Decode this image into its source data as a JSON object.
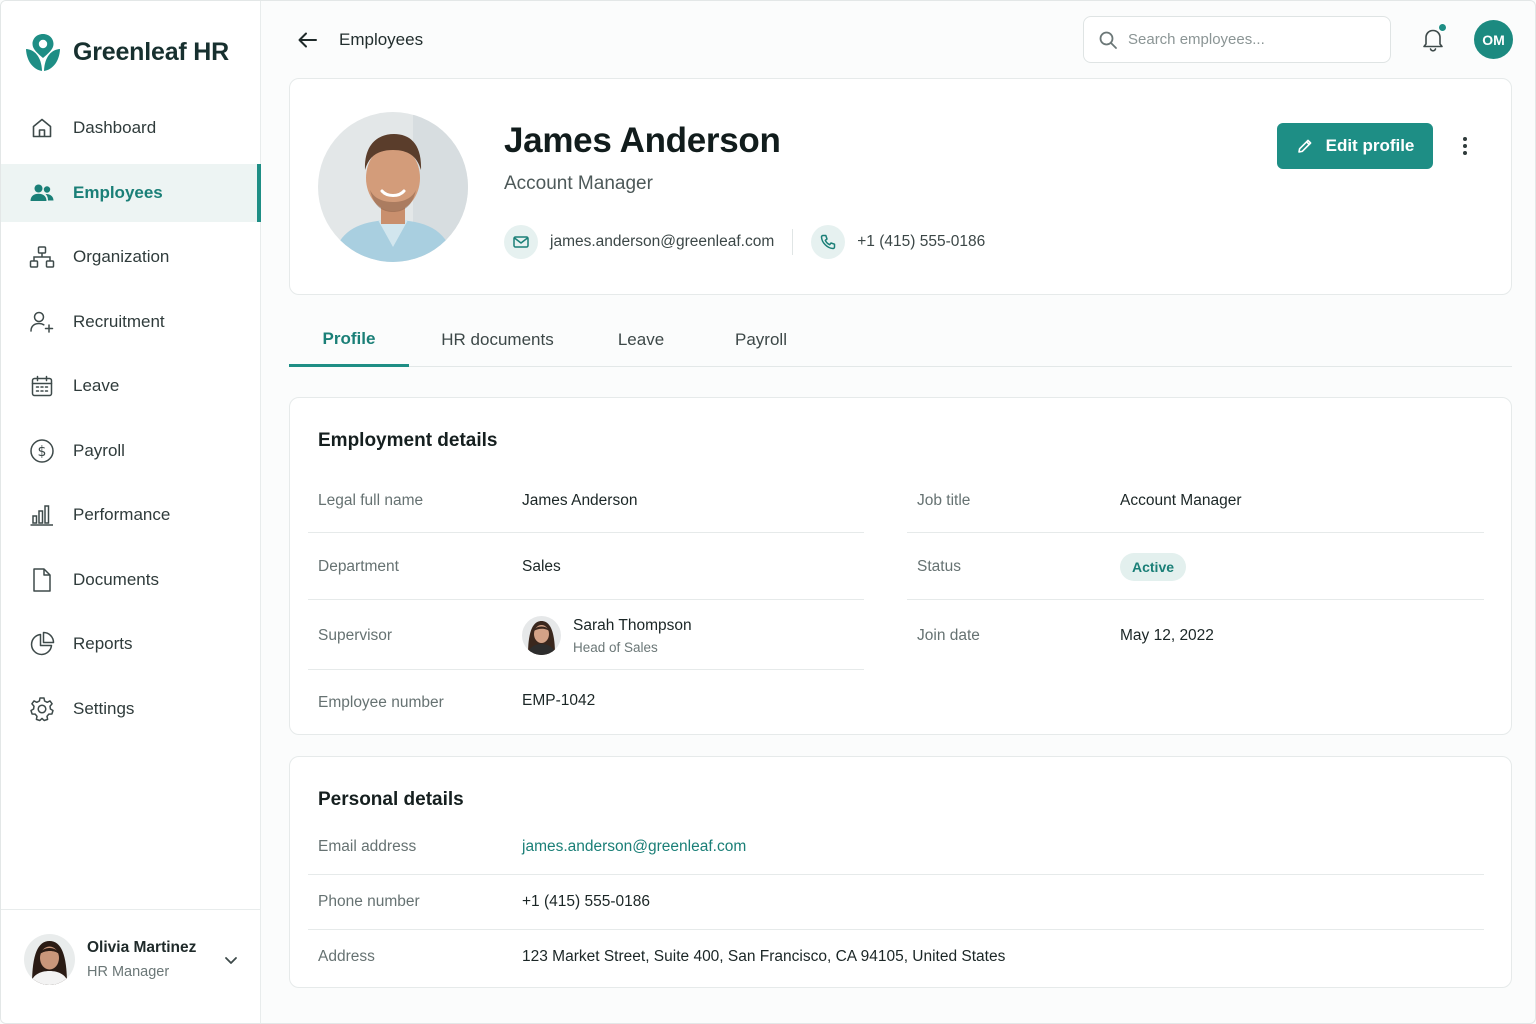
{
  "brand": {
    "name": "Greenleaf HR",
    "accent": "#1e8e85"
  },
  "sidebar": {
    "items": [
      {
        "label": "Dashboard",
        "icon": "home-icon"
      },
      {
        "label": "Employees",
        "icon": "users-icon",
        "active": true
      },
      {
        "label": "Organization",
        "icon": "org-chart-icon"
      },
      {
        "label": "Recruitment",
        "icon": "user-add-icon"
      },
      {
        "label": "Leave",
        "icon": "calendar-icon"
      },
      {
        "label": "Payroll",
        "icon": "dollar-icon"
      },
      {
        "label": "Performance",
        "icon": "bar-chart-icon"
      },
      {
        "label": "Documents",
        "icon": "document-icon"
      },
      {
        "label": "Reports",
        "icon": "pie-chart-icon"
      },
      {
        "label": "Settings",
        "icon": "gear-icon"
      }
    ],
    "user": {
      "name": "Olivia Martinez",
      "role": "HR Manager"
    }
  },
  "topbar": {
    "breadcrumb": "Employees",
    "search_placeholder": "Search employees...",
    "avatar_initials": "OM"
  },
  "profile": {
    "name": "James Anderson",
    "title": "Account Manager",
    "email": "james.anderson@greenleaf.com",
    "phone": "+1 (415) 555-0186",
    "edit_label": "Edit profile"
  },
  "tabs": [
    "Profile",
    "HR documents",
    "Leave",
    "Payroll"
  ],
  "employment": {
    "title": "Employment details",
    "legal_name_label": "Legal full name",
    "legal_name": "James Anderson",
    "job_title_label": "Job title",
    "job_title": "Account Manager",
    "department_label": "Department",
    "department": "Sales",
    "status_label": "Status",
    "status": "Active",
    "supervisor_label": "Supervisor",
    "supervisor_name": "Sarah Thompson",
    "supervisor_role": "Head of Sales",
    "join_date_label": "Join date",
    "join_date": "May 12, 2022",
    "employee_number_label": "Employee number",
    "employee_number": "EMP-1042"
  },
  "personal": {
    "title": "Personal details",
    "email_label": "Email address",
    "email": "james.anderson@greenleaf.com",
    "phone_label": "Phone number",
    "phone": "+1 (415) 555-0186",
    "address_label": "Address",
    "address": "123 Market Street, Suite 400, San Francisco, CA 94105, United States"
  }
}
